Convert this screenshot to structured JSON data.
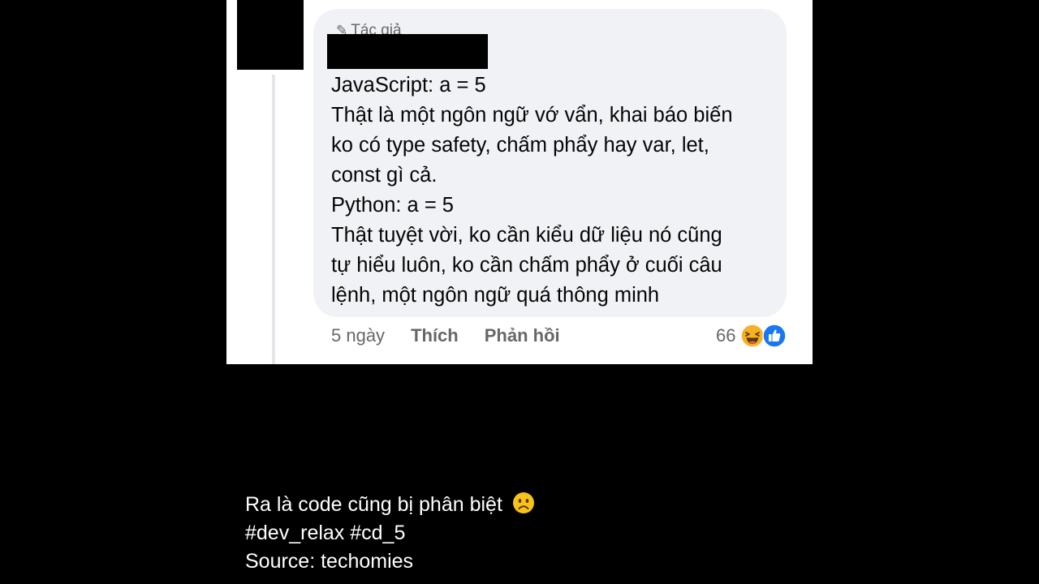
{
  "comment": {
    "author_badge": "Tác giả",
    "lines": [
      "JavaScript: a = 5",
      "Thật là một ngôn ngữ vớ vẩn, khai báo biến",
      "ko có type safety, chấm phẩy hay var, let,",
      "const gì cả.",
      "Python: a = 5",
      "Thật tuyệt vời, ko cần kiểu dữ liệu nó cũng",
      "tự hiểu luôn, ko cần chấm phẩy ở cuối câu",
      "lệnh, một ngôn ngữ quá thông minh"
    ],
    "time": "5 ngày",
    "like_label": "Thích",
    "reply_label": "Phản hồi",
    "reaction_count": "66",
    "reaction_icons": [
      "haha-icon",
      "like-icon"
    ]
  },
  "caption": {
    "line1": "Ra là code cũng bị phân biệt",
    "line2": "#dev_relax #cd_5",
    "line3": "Source: techomies"
  },
  "colors": {
    "bubble": "#f0f2f5",
    "secondary_text": "#65676b",
    "like_blue": "#1877f2",
    "haha_yellow": "#f7b125"
  }
}
